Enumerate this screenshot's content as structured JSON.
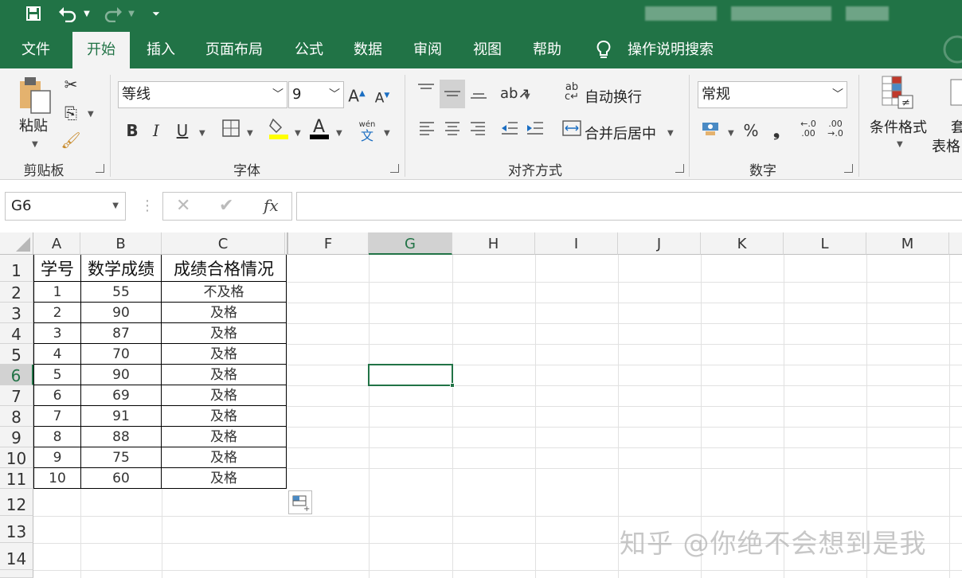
{
  "quick_access": {
    "save": "save-icon",
    "undo": "undo-icon",
    "redo": "redo-icon",
    "customize": "customize-icon"
  },
  "tabs": [
    "文件",
    "开始",
    "插入",
    "页面布局",
    "公式",
    "数据",
    "审阅",
    "视图",
    "帮助"
  ],
  "active_tab": "开始",
  "tell_me": "操作说明搜索",
  "ribbon": {
    "clipboard": {
      "label": "剪贴板",
      "paste": "粘贴"
    },
    "font": {
      "label": "字体",
      "font_name": "等线",
      "font_size": "9",
      "wen_top": "wén",
      "wen_bottom": "文"
    },
    "alignment": {
      "label": "对齐方式",
      "wrap_text": "自动换行",
      "merge_center": "合并后居中"
    },
    "number": {
      "label": "数字",
      "format": "常规",
      "percent": "%",
      "comma": "❟",
      "inc_decimal_top": "←.0",
      "inc_decimal_bottom": ".00",
      "dec_decimal_top": ".00",
      "dec_decimal_bottom": "→.0"
    },
    "styles": {
      "conditional_format": "条件格式",
      "table_format_1": "套",
      "table_format_2": "表格"
    }
  },
  "name_box": "G6",
  "formula_bar": {
    "cancel": "✕",
    "enter": "✔",
    "fx": "fx",
    "value": ""
  },
  "columns": [
    "A",
    "B",
    "C",
    "F",
    "G",
    "H",
    "I",
    "J",
    "K",
    "L",
    "M"
  ],
  "selected_column": "G",
  "rows": [
    "1",
    "2",
    "3",
    "4",
    "5",
    "6",
    "7",
    "8",
    "9",
    "10",
    "11",
    "12",
    "13",
    "14"
  ],
  "selected_row": "6",
  "table": {
    "headers": [
      "学号",
      "数学成绩",
      "成绩合格情况"
    ],
    "rows": [
      [
        "1",
        "55",
        "不及格"
      ],
      [
        "2",
        "90",
        "及格"
      ],
      [
        "3",
        "87",
        "及格"
      ],
      [
        "4",
        "70",
        "及格"
      ],
      [
        "5",
        "90",
        "及格"
      ],
      [
        "6",
        "69",
        "及格"
      ],
      [
        "7",
        "91",
        "及格"
      ],
      [
        "8",
        "88",
        "及格"
      ],
      [
        "9",
        "75",
        "及格"
      ],
      [
        "10",
        "60",
        "及格"
      ]
    ]
  },
  "watermark": "知乎 @你绝不会想到是我",
  "colors": {
    "accent": "#217346",
    "ribbon_bg": "#f3f3f3"
  }
}
